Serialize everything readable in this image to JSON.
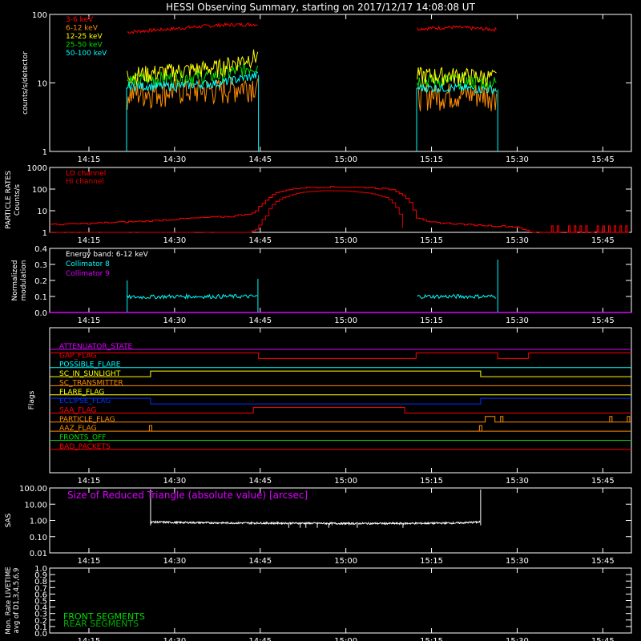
{
  "title": "HESSI Observing Summary, starting on 2017/12/17 14:08:08 UT",
  "time_axis": {
    "ticks": [
      "14:15",
      "14:30",
      "14:45",
      "15:00",
      "15:15",
      "15:30",
      "15:45"
    ],
    "tick_minutes": [
      15,
      30,
      45,
      60,
      75,
      90,
      105
    ],
    "range_minutes": [
      8.13,
      110
    ]
  },
  "colors": {
    "3-6 keV": "#ff0000",
    "6-12 keV": "#ff8c00",
    "12-25 keV": "#ffff00",
    "25-50 keV": "#00dd00",
    "50-100 keV": "#00ffff",
    "lo": "#ff0000",
    "hi": "#dd0000",
    "coll8": "#00ffff",
    "coll9": "#dd00ff",
    "front": "#00dd00",
    "rear": "#00aa00",
    "sas": "#ffffff"
  },
  "chart_data": [
    {
      "id": "count_rates",
      "type": "line",
      "ylabel": "counts/s/detector",
      "yscale": "log",
      "ylim": [
        1,
        100
      ],
      "ytick_labels": [
        "1",
        "10",
        "100"
      ],
      "ytick_values": [
        1,
        10,
        100
      ],
      "x_units": "minutes after 14:00 UT",
      "gaps": [
        [
          8.13,
          21.5
        ],
        [
          44.7,
          72.3
        ],
        [
          86.6,
          110
        ]
      ],
      "series": [
        {
          "name": "3-6 keV",
          "segments": [
            {
              "x": [
                21.7,
                30,
                38,
                44.6
              ],
              "y": [
                55,
                62,
                70,
                72
              ]
            },
            {
              "x": [
                72.5,
                79,
                86.5
              ],
              "y": [
                62,
                65,
                60
              ]
            }
          ]
        },
        {
          "name": "6-12 keV",
          "segments": [
            {
              "x": [
                21.7,
                30,
                38,
                44.6
              ],
              "y": [
                7,
                8,
                8,
                10
              ]
            },
            {
              "x": [
                72.5,
                79,
                86.5
              ],
              "y": [
                7,
                7,
                7
              ]
            }
          ]
        },
        {
          "name": "12-25 keV",
          "segments": [
            {
              "x": [
                21.7,
                30,
                38,
                44.6
              ],
              "y": [
                13,
                15,
                17,
                25
              ]
            },
            {
              "x": [
                72.5,
                79,
                86.5
              ],
              "y": [
                13,
                13,
                12
              ]
            }
          ]
        },
        {
          "name": "25-50 keV",
          "segments": [
            {
              "x": [
                21.7,
                30,
                38,
                44.6
              ],
              "y": [
                11,
                12,
                13,
                18
              ]
            },
            {
              "x": [
                72.5,
                79,
                86.5
              ],
              "y": [
                11,
                11,
                10
              ]
            }
          ]
        },
        {
          "name": "50-100 keV",
          "segments": [
            {
              "x": [
                21.7,
                30,
                38,
                44.6
              ],
              "y": [
                9,
                9,
                10,
                13
              ]
            },
            {
              "x": [
                72.5,
                79,
                86.5
              ],
              "y": [
                8.5,
                8.5,
                8
              ]
            }
          ]
        }
      ]
    },
    {
      "id": "particle_rates",
      "type": "line",
      "ylabel": "PARTICLE RATES Counts/s",
      "yscale": "log",
      "ylim": [
        1,
        1000
      ],
      "ytick_labels": [
        "1",
        "10",
        "100",
        "1000"
      ],
      "ytick_values": [
        1,
        10,
        100,
        1000
      ],
      "series": [
        {
          "name": "LO channel",
          "x": [
            8.13,
            15,
            25,
            33,
            40,
            44,
            46,
            48,
            52,
            56,
            60,
            64,
            68,
            70.5,
            72,
            74,
            82,
            90,
            92,
            110
          ],
          "y": [
            2.3,
            2.6,
            3.3,
            4.5,
            5.5,
            8,
            30,
            75,
            115,
            125,
            125,
            118,
            95,
            40,
            5,
            3,
            2.2,
            1.8,
            1,
            1
          ]
        },
        {
          "name": "HI channel",
          "x": [
            8.13,
            43,
            44.5,
            46,
            48,
            52,
            56,
            60,
            64,
            67,
            69,
            70
          ],
          "y": [
            1,
            1,
            1.5,
            6,
            30,
            70,
            85,
            82,
            65,
            40,
            10,
            1
          ]
        }
      ]
    },
    {
      "id": "modulation",
      "type": "line",
      "ylabel": "Normalized modulation",
      "ylim": [
        0,
        0.4
      ],
      "ytick_labels": [
        "0.0",
        "0.1",
        "0.2",
        "0.3",
        "0.4"
      ],
      "ytick_values": [
        0,
        0.1,
        0.2,
        0.3,
        0.4
      ],
      "annotation": "Energy band: 6-12 keV",
      "series": [
        {
          "name": "Collimator 8",
          "segments": [
            {
              "x": [
                21.7,
                30,
                38,
                44.6
              ],
              "y": [
                0.095,
                0.1,
                0.1,
                0.1
              ]
            },
            {
              "x": [
                72.5,
                79,
                86.5
              ],
              "y": [
                0.1,
                0.1,
                0.1
              ]
            }
          ],
          "spikes": [
            {
              "x": 21.7,
              "y": 0.2
            },
            {
              "x": 44.6,
              "y": 0.21
            },
            {
              "x": 86.6,
              "y": 0.33
            }
          ]
        },
        {
          "name": "Collimator 9",
          "x": [
            8.13,
            110
          ],
          "y": [
            0,
            0
          ]
        }
      ]
    },
    {
      "id": "flags",
      "type": "line",
      "ylabel": "Flags",
      "flags": [
        {
          "name": "ATTENUATOR_STATE",
          "color": "#dd00ff",
          "steps": [
            [
              8.13,
              0
            ]
          ]
        },
        {
          "name": "GAP_FLAG",
          "color": "#ff0000",
          "steps": [
            [
              8.13,
              1
            ],
            [
              44.7,
              0
            ],
            [
              72.3,
              1
            ],
            [
              86.6,
              0
            ],
            [
              92,
              1
            ]
          ]
        },
        {
          "name": "POSSIBLE_FLARE",
          "color": "#00ffff",
          "steps": [
            [
              8.13,
              0
            ]
          ]
        },
        {
          "name": "SC_IN_SUNLIGHT",
          "color": "#ffff00",
          "steps": [
            [
              8.13,
              0
            ],
            [
              25.8,
              1
            ],
            [
              83.6,
              0
            ]
          ]
        },
        {
          "name": "SC_TRANSMITTER",
          "color": "#ff8c00",
          "steps": [
            [
              8.13,
              0
            ]
          ]
        },
        {
          "name": "FLARE_FLAG",
          "color": "#ffff00",
          "steps": [
            [
              8.13,
              0
            ]
          ]
        },
        {
          "name": "ECLIPSE_FLAG",
          "color": "#0033ff",
          "steps": [
            [
              8.13,
              1
            ],
            [
              25.8,
              0
            ],
            [
              83.6,
              1
            ]
          ]
        },
        {
          "name": "SAA_FLAG",
          "color": "#ff0000",
          "steps": [
            [
              8.13,
              0
            ],
            [
              43.8,
              1
            ],
            [
              70.3,
              0
            ]
          ]
        },
        {
          "name": "PARTICLE_FLAG",
          "color": "#ff8c00",
          "steps": [
            [
              8.13,
              0
            ],
            [
              84.4,
              1
            ],
            [
              86.1,
              0
            ]
          ],
          "spikes": [
            87.3,
            106.4,
            109.5
          ]
        },
        {
          "name": "AAZ_FLAG",
          "color": "#ff8c00",
          "steps": [
            [
              8.13,
              0
            ]
          ],
          "spikes": [
            25.8,
            83.6
          ]
        },
        {
          "name": "FRONTS_OFF",
          "color": "#00dd00",
          "steps": [
            [
              8.13,
              0
            ]
          ]
        },
        {
          "name": "BAD_PACKETS",
          "color": "#ff0000",
          "steps": [
            [
              8.13,
              0
            ]
          ]
        }
      ]
    },
    {
      "id": "sas",
      "type": "line",
      "ylabel": "SAS",
      "yscale": "log",
      "ylim": [
        0.01,
        100
      ],
      "ytick_labels": [
        "0.01",
        "0.10",
        "1.00",
        "10.00",
        "100.00"
      ],
      "ytick_values": [
        0.01,
        0.1,
        1,
        10,
        100
      ],
      "annotation": "Size of Reduced Triangle (absolute value) [arcsec]",
      "series": [
        {
          "name": "SAS",
          "x": [
            25.8,
            30,
            40,
            50,
            60,
            70,
            80,
            83.5
          ],
          "y": [
            0.8,
            0.75,
            0.7,
            0.68,
            0.65,
            0.65,
            0.7,
            0.8
          ],
          "spikes": [
            {
              "x": 25.8,
              "y": 80
            },
            {
              "x": 83.6,
              "y": 80
            }
          ]
        }
      ]
    },
    {
      "id": "livetime",
      "type": "line",
      "ylabel": "Mon. Rate LIVETIME avg of D1,3,4,5,6,9",
      "ylim": [
        0,
        1
      ],
      "ytick_labels": [
        "0.0",
        "0.1",
        "0.2",
        "0.3",
        "0.4",
        "0.5",
        "0.6",
        "0.7",
        "0.8",
        "0.9",
        "1.0"
      ],
      "ytick_values": [
        0,
        0.1,
        0.2,
        0.3,
        0.4,
        0.5,
        0.6,
        0.7,
        0.8,
        0.9,
        1.0
      ],
      "legend": [
        "FRONT SEGMENTS",
        "REAR SEGMENTS"
      ],
      "series": []
    }
  ]
}
